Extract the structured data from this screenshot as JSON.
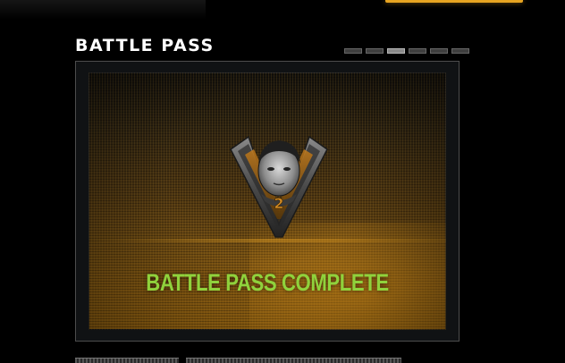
{
  "header": {
    "title": "BATTLE PASS"
  },
  "pager": {
    "total": 6,
    "active_index": 2
  },
  "card": {
    "status_text": "BATTLE PASS COMPLETE",
    "emblem": {
      "icon": "tier-chevron-emblem-icon",
      "tier_number": "2"
    }
  },
  "colors": {
    "accent": "#e7a421",
    "status_text": "#8fd23c",
    "card_gradient_top": "#12100c",
    "card_gradient_bottom": "#a36c12"
  }
}
